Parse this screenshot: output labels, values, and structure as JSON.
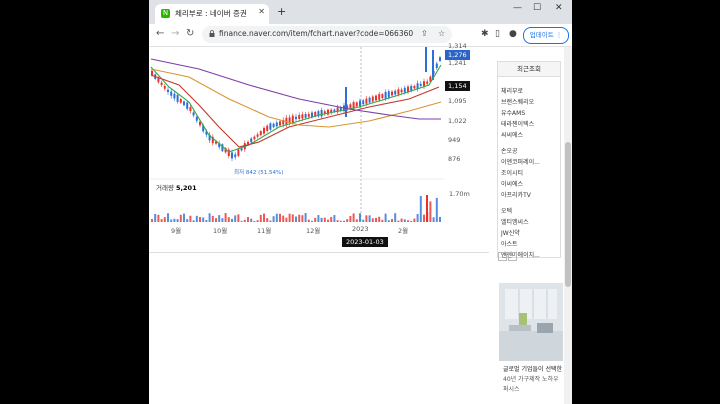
{
  "browser": {
    "tab_title": "체리부로 : 네이버 증권",
    "favicon_letter": "N",
    "url": "finance.naver.com/item/fchart.naver?code=066360",
    "update_label": "업데이트",
    "win_minimize": "—",
    "win_maximize": "☐",
    "win_close": "✕",
    "new_tab": "+"
  },
  "chart": {
    "price_axis": [
      "1,314",
      "1,241",
      "1,095",
      "1,022",
      "949",
      "876"
    ],
    "current_price": "1,276",
    "crosshair_price": "1,154",
    "low_label": "최저 842 (51.54%)",
    "volume_title": "거래량",
    "volume_value": "5,201",
    "volume_max": "1.70m",
    "months": [
      "9월",
      "10월",
      "11월",
      "12월",
      "2023",
      "2월"
    ],
    "crosshair_date": "2023-01-03",
    "colors": {
      "up": "#e5322d",
      "down": "#2d6fd6",
      "ma5": "#31a84f",
      "ma20": "#c0392b",
      "ma60": "#d99533",
      "ma120": "#7a3ea8",
      "tag_blue": "#2b64c6"
    }
  },
  "sidebar": {
    "recent_title": "최근조회",
    "groups": [
      [
        "체리부로",
        "브랜스퀘리오",
        "유수AMS",
        "테라젠이텍스",
        "씨씨에스"
      ],
      [
        "손오공",
        "이엔코퍼레이...",
        "조이시티",
        "이씨에스",
        "아프리카TV"
      ],
      [
        "오텍",
        "엘티엠씨스",
        "JW신약",
        "아스트",
        "엔젠아에이치..."
      ]
    ],
    "ad_line1": "글로벌 기업들이 선택한",
    "ad_line2": "40년 가구제작 노하우",
    "ad_line3": "퍼시스"
  }
}
